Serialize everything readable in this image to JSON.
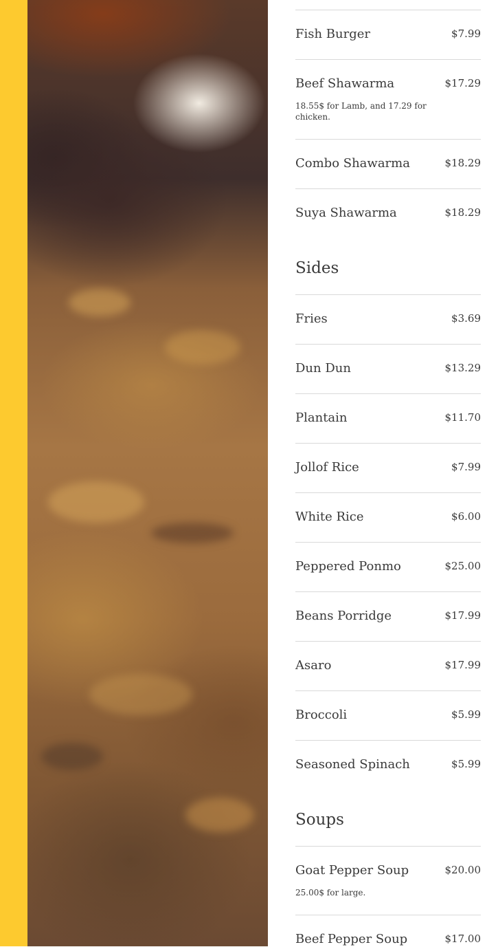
{
  "colors": {
    "accent": "#fdca2f",
    "text": "#3a3a3a",
    "divider": "#d9d9d9"
  },
  "photo": {
    "alt_semantic": "food-photo"
  },
  "burgers_shawarma": [
    {
      "name": "Fish Burger",
      "price": "$7.99"
    },
    {
      "name": "Beef Shawarma",
      "price": "$17.29",
      "description": "18.55$ for Lamb, and 17.29 for chicken."
    },
    {
      "name": "Combo Shawarma",
      "price": "$18.29"
    },
    {
      "name": "Suya Shawarma",
      "price": "$18.29"
    }
  ],
  "sides": {
    "title": "Sides",
    "items": [
      {
        "name": "Fries",
        "price": "$3.69"
      },
      {
        "name": "Dun Dun",
        "price": "$13.29"
      },
      {
        "name": "Plantain",
        "price": "$11.70"
      },
      {
        "name": "Jollof Rice",
        "price": "$7.99"
      },
      {
        "name": "White Rice",
        "price": "$6.00"
      },
      {
        "name": "Peppered Ponmo",
        "price": "$25.00"
      },
      {
        "name": "Beans Porridge",
        "price": "$17.99"
      },
      {
        "name": "Asaro",
        "price": "$17.99"
      },
      {
        "name": "Broccoli",
        "price": "$5.99"
      },
      {
        "name": "Seasoned Spinach",
        "price": "$5.99"
      }
    ]
  },
  "soups": {
    "title": "Soups",
    "items": [
      {
        "name": "Goat Pepper Soup",
        "price": "$20.00",
        "description": "25.00$ for large."
      },
      {
        "name": "Beef Pepper Soup",
        "price": "$17.00"
      }
    ]
  }
}
